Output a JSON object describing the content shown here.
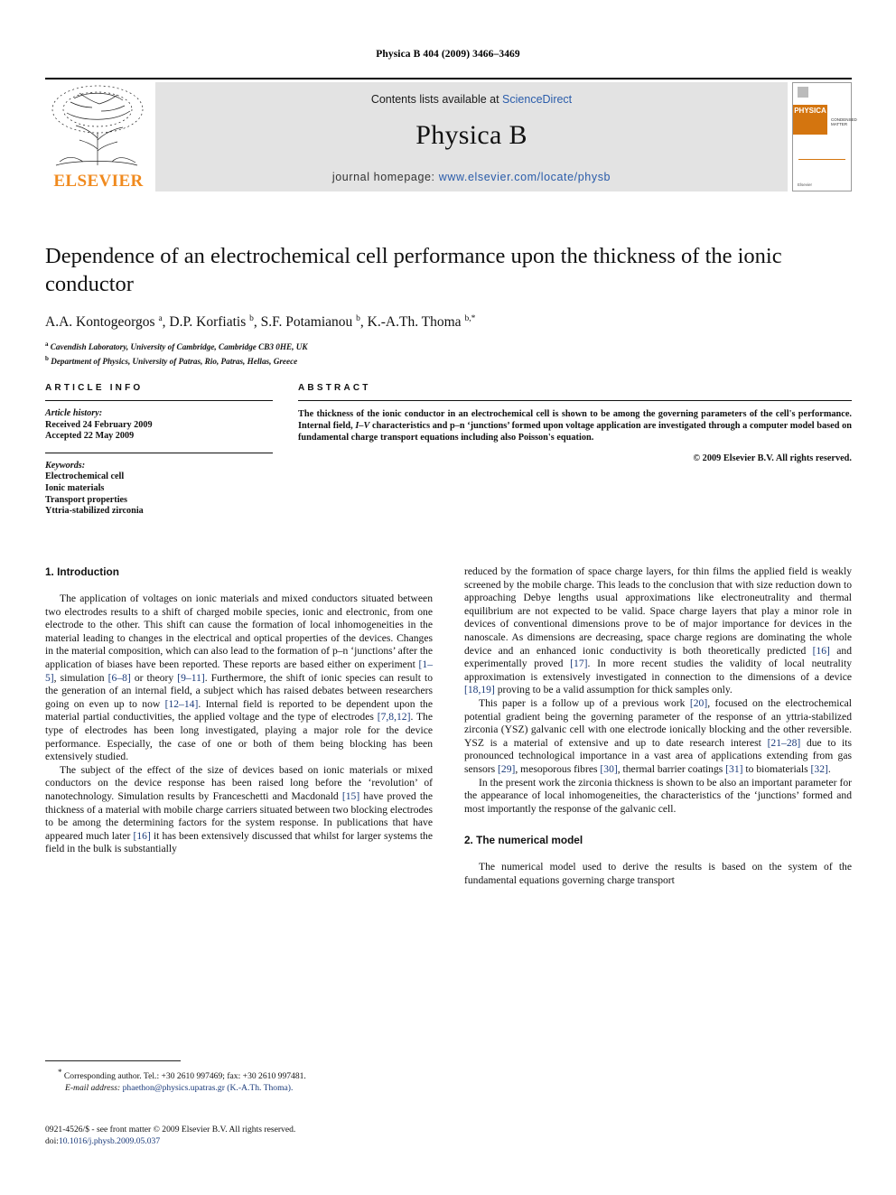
{
  "running_head": "Physica B 404 (2009) 3466–3469",
  "masthead": {
    "publisher_name": "ELSEVIER",
    "contents_prefix": "Contents lists available at ",
    "contents_link": "ScienceDirect",
    "journal_title": "Physica B",
    "homepage_prefix": "journal homepage: ",
    "homepage_url": "www.elsevier.com/locate/physb",
    "cover_brand": "PHYSICA",
    "cover_subtitle": "CONDENSED MATTER",
    "cover_footer": "Elsevier"
  },
  "article": {
    "title": "Dependence of an electrochemical cell performance upon the thickness of the ionic conductor",
    "authors_html": "A.A. Kontogeorgos <sup>a</sup>, D.P. Korfiatis <sup>b</sup>, S.F. Potamianou <sup>b</sup>, K.-A.Th. Thoma <sup>b,*</sup>",
    "affiliation_a": "Cavendish Laboratory, University of Cambridge, Cambridge CB3 0HE, UK",
    "affiliation_b": "Department of Physics, University of Patras, Rio, Patras, Hellas, Greece"
  },
  "article_info": {
    "heading": "ARTICLE INFO",
    "history_label": "Article history:",
    "received": "Received 24 February 2009",
    "accepted": "Accepted 22 May 2009",
    "keywords_label": "Keywords:",
    "keywords": [
      "Electrochemical cell",
      "Ionic materials",
      "Transport properties",
      "Yttria-stabilized zirconia"
    ]
  },
  "abstract": {
    "heading": "ABSTRACT",
    "text_part1": "The thickness of the ionic conductor in an electrochemical cell is shown to be among the governing parameters of the cell's performance. Internal field, ",
    "text_italic": "I–V",
    "text_part2": " characteristics and p–n ‘junctions’ formed upon voltage application are investigated through a computer model based on fundamental charge transport equations including also Poisson's equation.",
    "copyright": "© 2009 Elsevier B.V. All rights reserved."
  },
  "sections": {
    "introduction_heading": "1. Introduction",
    "numerical_model_heading": "2. The numerical model",
    "p1_a": "The application of voltages on ionic materials and mixed conductors situated between two electrodes results to a shift of charged mobile species, ionic and electronic, from one electrode to the other. This shift can cause the formation of local inhomogeneities in the material leading to changes in the electrical and optical properties of the devices. Changes in the material composition, which can also lead to the formation of p–n ‘junctions’ after the application of biases have been reported. These reports are based either on experiment ",
    "p1_r1": "[1–5]",
    "p1_b": ", simulation ",
    "p1_r2": "[6–8]",
    "p1_c": " or theory ",
    "p1_r3": "[9–11]",
    "p1_d": ". Furthermore, the shift of ionic species can result to the generation of an internal field, a subject which has raised debates between researchers going on even up to now ",
    "p1_r4": "[12–14]",
    "p1_e": ". Internal field is reported to be dependent upon the material partial conductivities, the applied voltage and the type of electrodes ",
    "p1_r5": "[7,8,12]",
    "p1_f": ". The type of electrodes has been long investigated, playing a major role for the device performance. Especially, the case of one or both of them being blocking has been extensively studied.",
    "p2_a": "The subject of the effect of the size of devices based on ionic materials or mixed conductors on the device response has been raised long before the ‘revolution’ of nanotechnology. Simulation results by Franceschetti and Macdonald ",
    "p2_r1": "[15]",
    "p2_b": " have proved the thickness of a material with mobile charge carriers situated between two blocking electrodes to be among the determining factors for the system response. In publications that have appeared much later ",
    "p2_r2": "[16]",
    "p2_c": " it has been extensively discussed that whilst for larger systems the field in the bulk is substantially",
    "p3_a": "reduced by the formation of space charge layers, for thin films the applied field is weakly screened by the mobile charge. This leads to the conclusion that with size reduction down to approaching Debye lengths usual approximations like electroneutrality and thermal equilibrium are not expected to be valid. Space charge layers that play a minor role in devices of conventional dimensions prove to be of major importance for devices in the nanoscale. As dimensions are decreasing, space charge regions are dominating the whole device and an enhanced ionic conductivity is both theoretically predicted ",
    "p3_r1": "[16]",
    "p3_b": " and experimentally proved ",
    "p3_r2": "[17]",
    "p3_c": ". In more recent studies the validity of local neutrality approximation is extensively investigated in connection to the dimensions of a device ",
    "p3_r3": "[18,19]",
    "p3_d": " proving to be a valid assumption for thick samples only.",
    "p4_a": "This paper is a follow up of a previous work ",
    "p4_r1": "[20]",
    "p4_b": ", focused on the electrochemical potential gradient being the governing parameter of the response of an yttria-stabilized zirconia (YSZ) galvanic cell with one electrode ionically blocking and the other reversible. YSZ is a material of extensive and up to date research interest ",
    "p4_r2": "[21–28]",
    "p4_c": " due to its pronounced technological importance in a vast area of applications extending from gas sensors ",
    "p4_r3": "[29]",
    "p4_d": ", mesoporous fibres ",
    "p4_r4": "[30]",
    "p4_e": ", thermal barrier coatings ",
    "p4_r5": "[31]",
    "p4_f": " to biomaterials ",
    "p4_r6": "[32]",
    "p4_g": ".",
    "p5": "In the present work the zirconia thickness is shown to be also an important parameter for the appearance of local inhomogeneities, the characteristics of the ‘junctions’ formed and most importantly the response of the galvanic cell.",
    "p6": "The numerical model used to derive the results is based on the system of the fundamental equations governing charge transport"
  },
  "footnote": {
    "corresponding": "Corresponding author. Tel.: +30 2610 997469; fax: +30 2610 997481.",
    "email_label": "E-mail address:",
    "email": "phaethon@physics.upatras.gr",
    "email_owner": "(K.-A.Th. Thoma)."
  },
  "imprint": {
    "issn_line": "0921-4526/$ - see front matter © 2009 Elsevier B.V. All rights reserved.",
    "doi_label": "doi:",
    "doi_value": "10.1016/j.physb.2009.05.037"
  },
  "colors": {
    "link": "#2a5caa",
    "reference": "#1a3a7a",
    "elsevier_orange": "#F08A1E",
    "band_gray": "#e3e3e3"
  }
}
